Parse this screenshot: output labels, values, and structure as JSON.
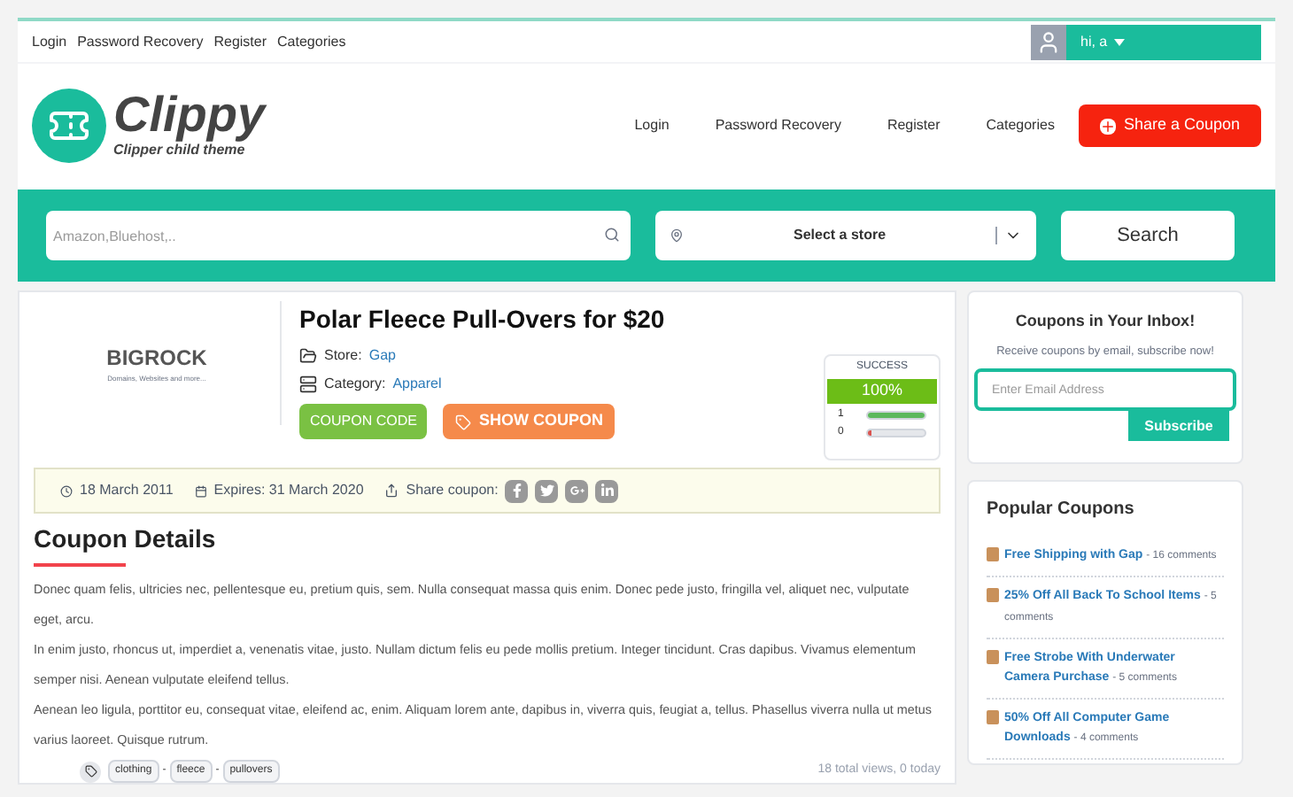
{
  "top_bar": {
    "links": [
      "Login",
      "Password Recovery",
      "Register",
      "Categories"
    ],
    "user": "hi, a"
  },
  "header": {
    "logo": "Clippy",
    "tagline": "Clipper child theme",
    "nav": [
      "Login",
      "Password Recovery",
      "Register",
      "Categories"
    ],
    "share_button": "Share a Coupon"
  },
  "search": {
    "placeholder": "Amazon,Bluehost,..",
    "store_select": "Select a store",
    "button": "Search"
  },
  "coupon": {
    "store_logo": "BIGROCK",
    "store_logo_tagline": "Domains, Websites and more...",
    "title": "Polar Fleece Pull-Overs for $20",
    "store_label": "Store:",
    "store": "Gap",
    "category_label": "Category:",
    "category": "Apparel",
    "code_button": "COUPON CODE",
    "show_button": "SHOW COUPON",
    "success": {
      "label": "SUCCESS",
      "percent": "100%",
      "votes": [
        {
          "count": "1",
          "kind": "up",
          "level": 1
        },
        {
          "count": "0",
          "kind": "down",
          "level": 0.05
        }
      ]
    },
    "meta": {
      "date": "18 March 2011",
      "expires": "Expires: 31 March 2020",
      "share": "Share coupon:"
    }
  },
  "details": {
    "heading": "Coupon Details",
    "paragraphs": [
      "Donec quam felis, ultricies nec, pellentesque eu, pretium quis, sem. Nulla consequat massa quis enim. Donec pede justo, fringilla vel, aliquet nec, vulputate eget, arcu.",
      "In enim justo, rhoncus ut, imperdiet a, venenatis vitae, justo. Nullam dictum felis eu pede mollis pretium. Integer tincidunt. Cras dapibus. Vivamus elementum semper nisi. Aenean vulputate eleifend tellus.",
      "Aenean leo ligula, porttitor eu, consequat vitae, eleifend ac, enim. Aliquam lorem ante, dapibus in, viverra quis, feugiat a, tellus. Phasellus viverra nulla ut metus varius laoreet. Quisque rutrum."
    ],
    "tags": [
      "clothing",
      "fleece",
      "pullovers"
    ],
    "tag_separator": "-",
    "views": "18 total views, 0 today"
  },
  "newsletter": {
    "title": "Coupons in Your Inbox!",
    "text": "Receive coupons by email, subscribe now!",
    "placeholder": "Enter Email Address",
    "button": "Subscribe"
  },
  "popular": {
    "title": "Popular Coupons",
    "items": [
      {
        "title": "Free Shipping with Gap",
        "comments": "- 16 comments"
      },
      {
        "title": "25% Off All Back To School Items",
        "comments": "- 5 comments"
      },
      {
        "title": "Free Strobe With Underwater Camera Purchase",
        "comments": "- 5 comments"
      },
      {
        "title": "50% Off All Computer Game Downloads",
        "comments": "- 4 comments"
      }
    ]
  }
}
